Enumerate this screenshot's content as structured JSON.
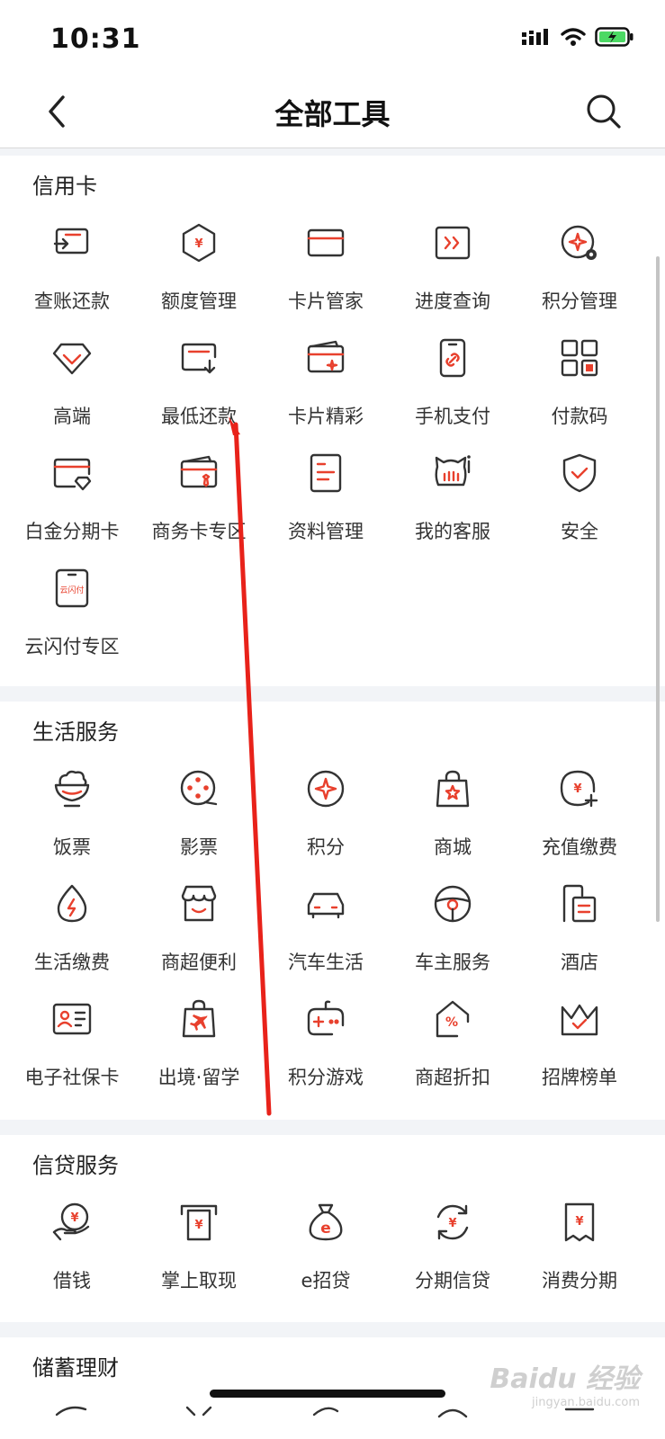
{
  "status_bar": {
    "time": "10:31"
  },
  "nav": {
    "title": "全部工具"
  },
  "sections": {
    "credit_card": {
      "title": "信用卡",
      "items": [
        "查账还款",
        "额度管理",
        "卡片管家",
        "进度查询",
        "积分管理",
        "高端",
        "最低还款",
        "卡片精彩",
        "手机支付",
        "付款码",
        "白金分期卡",
        "商务卡专区",
        "资料管理",
        "我的客服",
        "安全",
        "云闪付专区"
      ]
    },
    "life": {
      "title": "生活服务",
      "items": [
        "饭票",
        "影票",
        "积分",
        "商城",
        "充值缴费",
        "生活缴费",
        "商超便利",
        "汽车生活",
        "车主服务",
        "酒店",
        "电子社保卡",
        "出境·留学",
        "积分游戏",
        "商超折扣",
        "招牌榜单"
      ]
    },
    "loan": {
      "title": "信贷服务",
      "items": [
        "借钱",
        "掌上取现",
        "e招贷",
        "分期信贷",
        "消费分期"
      ]
    },
    "savings": {
      "title": "储蓄理财"
    }
  },
  "icon_text": {
    "unionpay": "云闪付",
    "yuan": "¥",
    "percent": "%",
    "e": "e"
  },
  "watermark": {
    "brand": "Baidu 经验",
    "url": "jingyan.baidu.com"
  },
  "colors": {
    "accent": "#e8402d",
    "icon_stroke": "#333333",
    "band": "#f2f4f7"
  }
}
